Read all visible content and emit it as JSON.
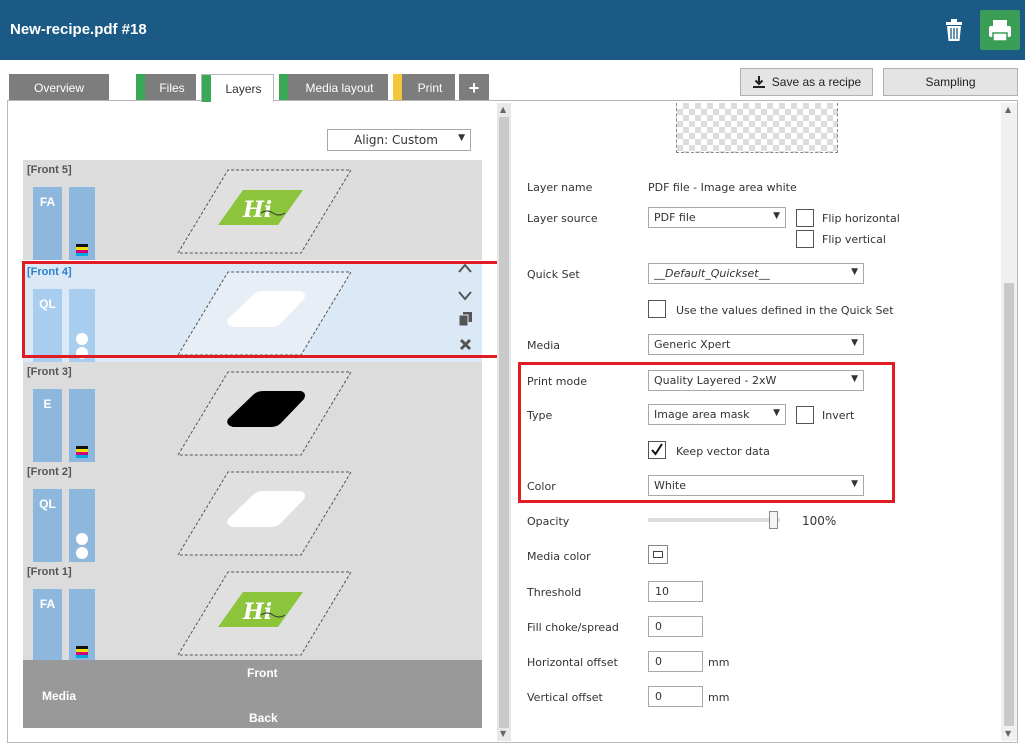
{
  "window": {
    "title": "New-recipe.pdf #18"
  },
  "tabs": [
    {
      "label": "Overview",
      "stripe": ""
    },
    {
      "label": "Files",
      "stripe": "#3aa857"
    },
    {
      "label": "Layers",
      "stripe": "#3aa857"
    },
    {
      "label": "Media layout",
      "stripe": "#3aa857"
    },
    {
      "label": "Print",
      "stripe": "#f2c73c"
    }
  ],
  "toolbar": {
    "save_recipe": "Save as a recipe",
    "sampling": "Sampling"
  },
  "align": {
    "label": "Align: Custom"
  },
  "layers": [
    {
      "name": "[Front 5]",
      "mode": "FA",
      "ink": "cmyk",
      "art": "hi"
    },
    {
      "name": "[Front 4]",
      "mode": "QL",
      "ink": "white",
      "art": "white",
      "selected": true
    },
    {
      "name": "[Front 3]",
      "mode": "E",
      "ink": "cmyk",
      "art": "black"
    },
    {
      "name": "[Front 2]",
      "mode": "QL",
      "ink": "white",
      "art": "white"
    },
    {
      "name": "[Front 1]",
      "mode": "FA",
      "ink": "cmyk",
      "art": "hi"
    }
  ],
  "media_bar": {
    "front": "Front",
    "media": "Media",
    "back": "Back"
  },
  "props": {
    "layer_name": {
      "label": "Layer name",
      "value": "PDF file - Image area white"
    },
    "layer_source": {
      "label": "Layer source",
      "value": "PDF file",
      "flip_h": "Flip horizontal",
      "flip_v": "Flip vertical"
    },
    "quick_set": {
      "label": "Quick Set",
      "value": "__Default_Quickset__",
      "use_values": "Use the values defined in the Quick Set"
    },
    "media": {
      "label": "Media",
      "value": "Generic Xpert"
    },
    "print_mode": {
      "label": "Print mode",
      "value": "Quality Layered - 2xW"
    },
    "type": {
      "label": "Type",
      "value": "Image area mask",
      "invert": "Invert",
      "keep_vector": "Keep vector data",
      "keep_vector_checked": true
    },
    "color": {
      "label": "Color",
      "value": "White"
    },
    "opacity": {
      "label": "Opacity",
      "value": "100%",
      "fraction": 1.0
    },
    "media_color": {
      "label": "Media color"
    },
    "threshold": {
      "label": "Threshold",
      "value": "10"
    },
    "fill_choke": {
      "label": "Fill choke/spread",
      "value": "0"
    },
    "h_offset": {
      "label": "Horizontal offset",
      "value": "0",
      "unit": "mm"
    },
    "v_offset": {
      "label": "Vertical offset",
      "value": "0",
      "unit": "mm"
    }
  },
  "colors": {
    "titlebar": "#1a5a85",
    "print_button": "#3a9e57",
    "highlight": "#e01b24",
    "mode_tile": "#8eb7dd"
  }
}
